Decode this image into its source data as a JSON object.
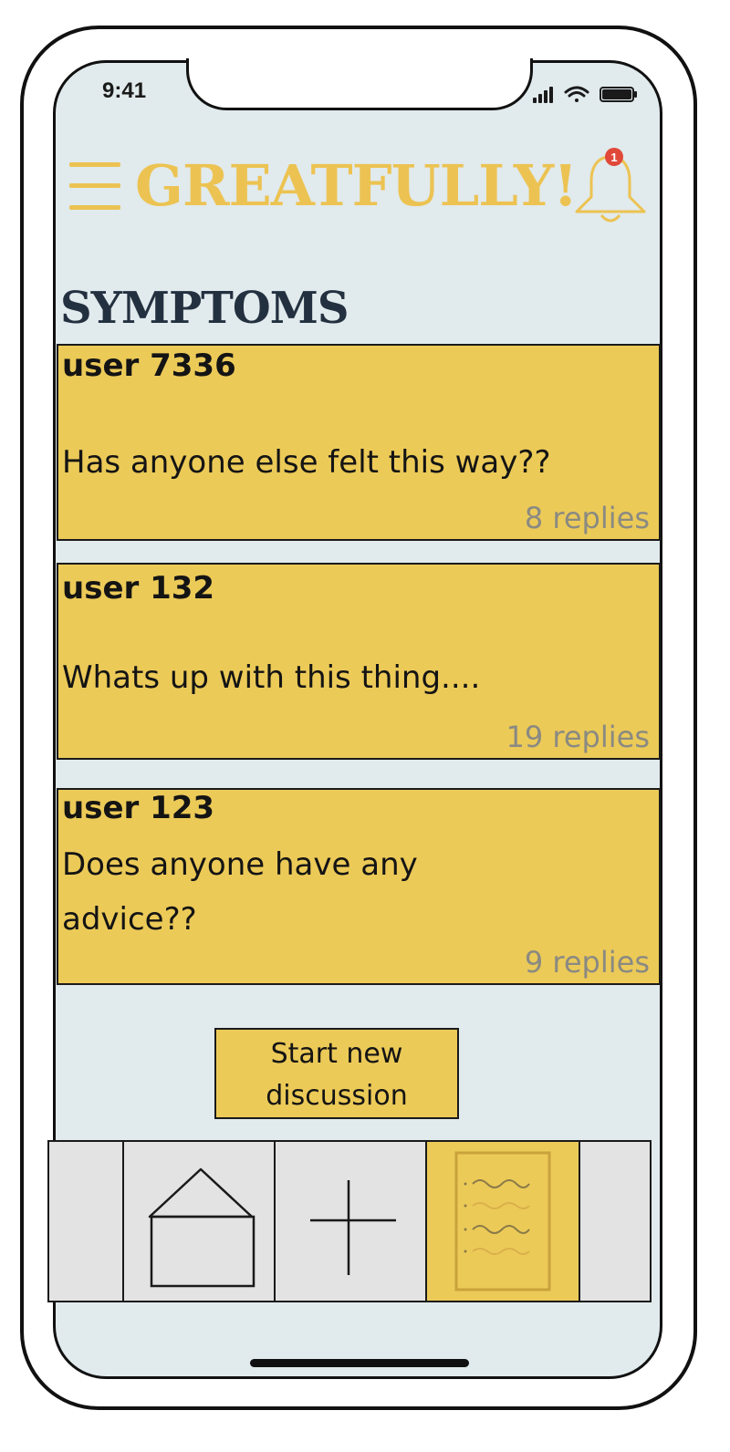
{
  "status_bar": {
    "time": "9:41",
    "icons": [
      "signal-icon",
      "wifi-icon",
      "battery-icon"
    ]
  },
  "header": {
    "app_title": "GREATFULLY!",
    "menu_icon": "hamburger-menu-icon",
    "notification_icon": "bell-icon",
    "notification_count": "1"
  },
  "page": {
    "section_title": "SYMPTOMS"
  },
  "posts": [
    {
      "user": "user 7336",
      "message": "Has anyone else felt this way??",
      "replies": "8 replies"
    },
    {
      "user": "user 132",
      "message": "Whats up with this thing....",
      "replies": "19 replies"
    },
    {
      "user": "user 123",
      "message": "Does anyone have any advice??",
      "replies": "9 replies"
    }
  ],
  "actions": {
    "new_discussion_label": "Start new discussion"
  },
  "tab_bar": {
    "tabs": [
      {
        "id": "blank-left",
        "icon": ""
      },
      {
        "id": "home",
        "icon": "home-icon"
      },
      {
        "id": "add",
        "icon": "plus-icon"
      },
      {
        "id": "forum",
        "icon": "document-list-icon",
        "active": true
      },
      {
        "id": "blank-right",
        "icon": ""
      }
    ]
  },
  "colors": {
    "accent": "#ecc352",
    "card": "#ecca58",
    "background": "#e1eaec",
    "heading": "#233040",
    "badge": "#e0493a",
    "muted": "#8a8a82"
  }
}
